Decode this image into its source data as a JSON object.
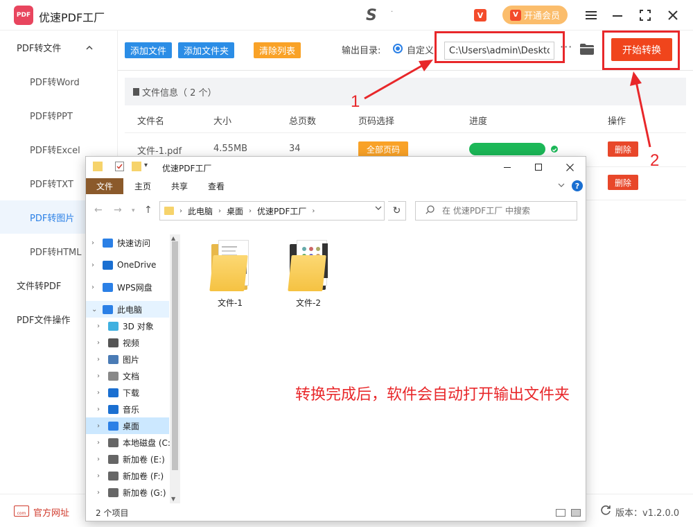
{
  "app": {
    "logo_text": "PDF",
    "title": "优速PDF工厂",
    "brand_mark": "S",
    "brand_dot": "·",
    "vip_badge_text": "V",
    "vip_label": "开通会员",
    "window_controls": [
      "menu-icon",
      "minimize-icon",
      "maximize-icon",
      "close-icon"
    ]
  },
  "sidebar": {
    "groups": [
      {
        "label": "PDF转文件",
        "expanded": true
      },
      {
        "label": "文件转PDF"
      },
      {
        "label": "PDF文件操作"
      }
    ],
    "items": [
      "PDF转Word",
      "PDF转PPT",
      "PDF转Excel",
      "PDF转TXT",
      "PDF转图片",
      "PDF转HTML"
    ],
    "active_item": "PDF转图片"
  },
  "toolbar": {
    "add_file": "添加文件",
    "add_folder": "添加文件夹",
    "clear_list": "清除列表",
    "output_label": "输出目录:",
    "custom_label": "自定义",
    "output_path": "C:\\Users\\admin\\Desktop",
    "more": "···",
    "start": "开始转换"
  },
  "file_panel": {
    "info_label": "文件信息（ 2 个）",
    "columns": [
      "文件名",
      "大小",
      "总页数",
      "页码选择",
      "进度",
      "操作"
    ],
    "rows": [
      {
        "name": "文件-1.pdf",
        "size": "4.55MB",
        "pages": "34",
        "page_select": "全部页码",
        "progress": 1.0,
        "action": "删除"
      },
      {
        "action": "删除"
      }
    ]
  },
  "annotations": {
    "arrow1_label": "1",
    "arrow2_label": "2",
    "message": "转换完成后，软件会自动打开输出文件夹"
  },
  "footer": {
    "site_icon_text": "com",
    "site_label": "官方网址",
    "version": "版本：v1.2.0.0"
  },
  "explorer": {
    "title": "优速PDF工厂",
    "ribbon_tabs": [
      "文件",
      "主页",
      "共享",
      "查看"
    ],
    "help": "?",
    "breadcrumb": [
      "此电脑",
      "桌面",
      "优速PDF工厂"
    ],
    "search_placeholder": "在 优速PDF工厂 中搜索",
    "tree": [
      {
        "label": "快速访问",
        "icon": "star-icon",
        "color": "#2b80e6"
      },
      {
        "label": "OneDrive",
        "icon": "cloud-icon",
        "color": "#1a6fd1"
      },
      {
        "label": "WPS网盘",
        "icon": "cloud-icon",
        "color": "#2b80e6"
      },
      {
        "label": "此电脑",
        "icon": "pc-icon",
        "color": "#2b80e6"
      },
      {
        "label": "3D 对象",
        "icon": "cube-icon",
        "color": "#3fb0e0"
      },
      {
        "label": "视频",
        "icon": "video-icon",
        "color": "#555"
      },
      {
        "label": "图片",
        "icon": "image-icon",
        "color": "#4a7bb5"
      },
      {
        "label": "文档",
        "icon": "doc-icon",
        "color": "#888"
      },
      {
        "label": "下载",
        "icon": "download-icon",
        "color": "#1a6fd1"
      },
      {
        "label": "音乐",
        "icon": "music-icon",
        "color": "#1a6fd1"
      },
      {
        "label": "桌面",
        "icon": "desktop-icon",
        "color": "#2b80e6"
      },
      {
        "label": "本地磁盘 (C:",
        "icon": "disk-icon",
        "color": "#666"
      },
      {
        "label": "新加卷 (E:)",
        "icon": "drive-icon",
        "color": "#666"
      },
      {
        "label": "新加卷 (F:)",
        "icon": "drive-icon",
        "color": "#666"
      },
      {
        "label": "新加卷 (G:)",
        "icon": "drive-icon",
        "color": "#666"
      }
    ],
    "files": [
      "文件-1",
      "文件-2"
    ],
    "status": "2 个项目"
  }
}
